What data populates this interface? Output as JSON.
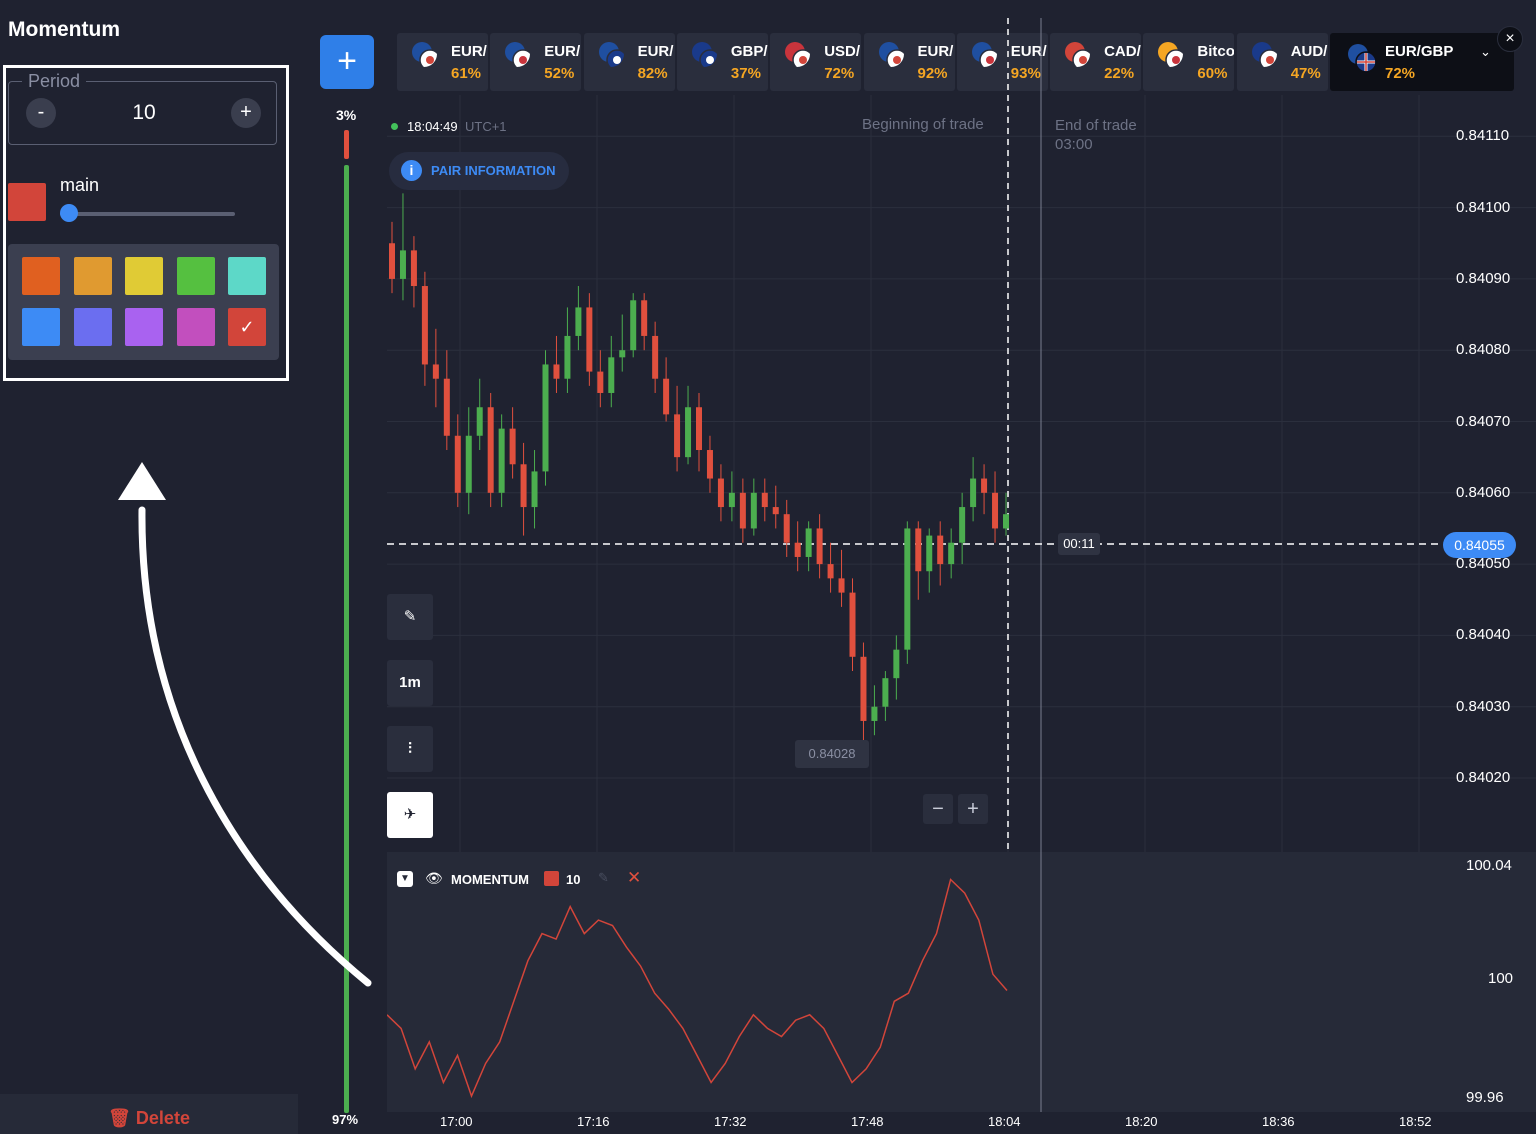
{
  "panel": {
    "title": "Momentum",
    "period_label": "Period",
    "period_value": "10",
    "minus_label": "-",
    "plus_label": "+",
    "line_label": "main",
    "line_color": "#d2453a",
    "palette": [
      "#e06020",
      "#e09a30",
      "#e0cb35",
      "#55c040",
      "#5dd8c8",
      "#3d8bf5",
      "#6b6ef0",
      "#a962f0",
      "#c24fbe",
      "#d2453a"
    ],
    "selected_check": "✓",
    "delete_label": "Delete"
  },
  "toolbar": {
    "add_label": "+"
  },
  "percent_bar": {
    "top": "3%",
    "bottom": "97%",
    "red_fraction": 0.03
  },
  "assets": [
    {
      "symbol": "EUR/",
      "payout": "61%",
      "flag": "eur-jpy"
    },
    {
      "symbol": "EUR/",
      "payout": "52%",
      "flag": "eur-usd"
    },
    {
      "symbol": "EUR/",
      "payout": "82%",
      "flag": "eur-aud"
    },
    {
      "symbol": "GBP/",
      "payout": "37%",
      "flag": "gbp-aud"
    },
    {
      "symbol": "USD/",
      "payout": "72%",
      "flag": "usd-cad"
    },
    {
      "symbol": "EUR/",
      "payout": "92%",
      "flag": "eur-jpy"
    },
    {
      "symbol": "EUR/",
      "payout": "93%",
      "flag": "eur-usd"
    },
    {
      "symbol": "CAD/",
      "payout": "22%",
      "flag": "cad-jpy"
    },
    {
      "symbol": "Bitco",
      "payout": "60%",
      "flag": "btc-usd"
    },
    {
      "symbol": "AUD/",
      "payout": "47%",
      "flag": "aud-jpy"
    }
  ],
  "active_asset": {
    "symbol": "EUR/GBP",
    "payout": "72%",
    "close": "×",
    "chevron": "⌄"
  },
  "chart": {
    "time": "18:04:49",
    "timezone": "UTC+1",
    "pair_info": "PAIR INFORMATION",
    "begin_label": "Beginning of trade",
    "end_label": "End of trade",
    "end_time": "03:00",
    "current_price": "0.84055",
    "timer": "00:11",
    "low_price": "0.84028",
    "timeframe": "1m",
    "zoom_minus": "−",
    "zoom_plus": "+",
    "y_labels": [
      "0.84110",
      "0.84100",
      "0.84090",
      "0.84080",
      "0.84070",
      "0.84060",
      "0.84050",
      "0.84040",
      "0.84030",
      "0.84020"
    ],
    "x_labels": [
      "17:00",
      "17:16",
      "17:32",
      "17:48",
      "18:04",
      "18:20",
      "18:36",
      "18:52"
    ]
  },
  "momentum": {
    "name": "MOMENTUM",
    "period": "10",
    "y_labels": [
      "100.04",
      "100",
      "99.96"
    ]
  },
  "chart_data": {
    "type": "candlestick",
    "ylim": [
      0.84015,
      0.84115
    ],
    "candles": [
      [
        0.84095,
        0.8409,
        0.84098,
        0.84088
      ],
      [
        0.8409,
        0.84094,
        0.84102,
        0.84087
      ],
      [
        0.84094,
        0.84089,
        0.84096,
        0.84086
      ],
      [
        0.84089,
        0.84078,
        0.84091,
        0.84075
      ],
      [
        0.84078,
        0.84076,
        0.84083,
        0.84072
      ],
      [
        0.84076,
        0.84068,
        0.8408,
        0.84066
      ],
      [
        0.84068,
        0.8406,
        0.84071,
        0.84058
      ],
      [
        0.8406,
        0.84068,
        0.84072,
        0.84057
      ],
      [
        0.84068,
        0.84072,
        0.84076,
        0.84066
      ],
      [
        0.84072,
        0.8406,
        0.84074,
        0.84058
      ],
      [
        0.8406,
        0.84069,
        0.84071,
        0.84058
      ],
      [
        0.84069,
        0.84064,
        0.84072,
        0.84062
      ],
      [
        0.84064,
        0.84058,
        0.84067,
        0.84054
      ],
      [
        0.84058,
        0.84063,
        0.84066,
        0.84055
      ],
      [
        0.84063,
        0.84078,
        0.8408,
        0.84061
      ],
      [
        0.84078,
        0.84076,
        0.84082,
        0.84074
      ],
      [
        0.84076,
        0.84082,
        0.84086,
        0.84074
      ],
      [
        0.84082,
        0.84086,
        0.84089,
        0.8408
      ],
      [
        0.84086,
        0.84077,
        0.84088,
        0.84075
      ],
      [
        0.84077,
        0.84074,
        0.8408,
        0.84072
      ],
      [
        0.84074,
        0.84079,
        0.84082,
        0.84072
      ],
      [
        0.84079,
        0.8408,
        0.84085,
        0.84077
      ],
      [
        0.8408,
        0.84087,
        0.84088,
        0.84079
      ],
      [
        0.84087,
        0.84082,
        0.84088,
        0.8408
      ],
      [
        0.84082,
        0.84076,
        0.84084,
        0.84074
      ],
      [
        0.84076,
        0.84071,
        0.84079,
        0.8407
      ],
      [
        0.84071,
        0.84065,
        0.84075,
        0.84063
      ],
      [
        0.84065,
        0.84072,
        0.84075,
        0.84064
      ],
      [
        0.84072,
        0.84066,
        0.84074,
        0.84063
      ],
      [
        0.84066,
        0.84062,
        0.84068,
        0.8406
      ],
      [
        0.84062,
        0.84058,
        0.84064,
        0.84056
      ],
      [
        0.84058,
        0.8406,
        0.84063,
        0.84056
      ],
      [
        0.8406,
        0.84055,
        0.84062,
        0.84053
      ],
      [
        0.84055,
        0.8406,
        0.84062,
        0.84054
      ],
      [
        0.8406,
        0.84058,
        0.84062,
        0.84056
      ],
      [
        0.84058,
        0.84057,
        0.84061,
        0.84055
      ],
      [
        0.84057,
        0.84053,
        0.84059,
        0.84051
      ],
      [
        0.84053,
        0.84051,
        0.84056,
        0.84049
      ],
      [
        0.84051,
        0.84055,
        0.84056,
        0.84049
      ],
      [
        0.84055,
        0.8405,
        0.84057,
        0.84048
      ],
      [
        0.8405,
        0.84048,
        0.84053,
        0.84046
      ],
      [
        0.84048,
        0.84046,
        0.84052,
        0.84044
      ],
      [
        0.84046,
        0.84037,
        0.84048,
        0.84035
      ],
      [
        0.84037,
        0.84028,
        0.84039,
        0.84025
      ],
      [
        0.84028,
        0.8403,
        0.84033,
        0.84026
      ],
      [
        0.8403,
        0.84034,
        0.84035,
        0.84028
      ],
      [
        0.84034,
        0.84038,
        0.8404,
        0.84031
      ],
      [
        0.84038,
        0.84055,
        0.84056,
        0.84036
      ],
      [
        0.84055,
        0.84049,
        0.84056,
        0.84045
      ],
      [
        0.84049,
        0.84054,
        0.84055,
        0.84046
      ],
      [
        0.84054,
        0.8405,
        0.84056,
        0.84047
      ],
      [
        0.8405,
        0.84053,
        0.84055,
        0.84048
      ],
      [
        0.84053,
        0.84058,
        0.8406,
        0.8405
      ],
      [
        0.84058,
        0.84062,
        0.84065,
        0.84056
      ],
      [
        0.84062,
        0.8406,
        0.84064,
        0.84057
      ],
      [
        0.8406,
        0.84055,
        0.84063,
        0.84053
      ],
      [
        0.84055,
        0.84057,
        0.8406,
        0.84054
      ]
    ],
    "momentum": {
      "ylim": [
        99.96,
        100.045
      ],
      "values": [
        99.99,
        99.985,
        99.97,
        99.98,
        99.965,
        99.975,
        99.96,
        99.972,
        99.98,
        99.995,
        100.01,
        100.02,
        100.018,
        100.03,
        100.02,
        100.025,
        100.023,
        100.015,
        100.008,
        99.998,
        99.992,
        99.985,
        99.975,
        99.965,
        99.972,
        99.982,
        99.99,
        99.985,
        99.982,
        99.988,
        99.99,
        99.985,
        99.975,
        99.965,
        99.97,
        99.978,
        99.995,
        99.998,
        100.01,
        100.02,
        100.04,
        100.035,
        100.025,
        100.005,
        99.999
      ]
    }
  }
}
